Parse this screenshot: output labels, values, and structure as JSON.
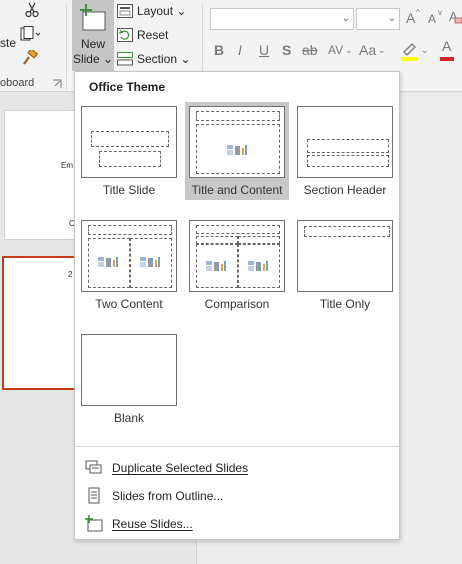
{
  "ribbon": {
    "clipboard": {
      "paste_partial": "ste",
      "group_label_partial": "oboard"
    },
    "new_slide": {
      "line1": "New",
      "line2": "Slide ⌄"
    },
    "slides_group": {
      "layout": "Layout ⌄",
      "reset": "Reset",
      "section": "Section ⌄"
    },
    "font": {
      "name_value": "",
      "size_value": "",
      "grow": "A",
      "shrink": "A",
      "bold": "B",
      "italic": "I",
      "underline": "U",
      "shadow": "S",
      "strike": "ab",
      "spacing": "AV",
      "case": "Aa",
      "color": "A"
    }
  },
  "thumbnails": {
    "slide1_text1": "Em",
    "slide1_text2": "C",
    "slide2_text": "2"
  },
  "gallery": {
    "header": "Office Theme",
    "layouts": [
      {
        "label": "Title Slide"
      },
      {
        "label": "Title and Content",
        "selected": true
      },
      {
        "label": "Section Header"
      },
      {
        "label": "Two Content"
      },
      {
        "label": "Comparison"
      },
      {
        "label": "Title Only"
      },
      {
        "label": "Blank"
      }
    ],
    "menu": [
      {
        "label": "Duplicate Selected Slides",
        "icon": "duplicate-slides-icon"
      },
      {
        "label": "Slides from Outline...",
        "icon": "outline-document-icon"
      },
      {
        "label": "Reuse Slides...",
        "icon": "reuse-slides-icon"
      }
    ]
  },
  "colors": {
    "accent_red": "#c43e1c",
    "selected_tile": "#c8c8c8"
  }
}
